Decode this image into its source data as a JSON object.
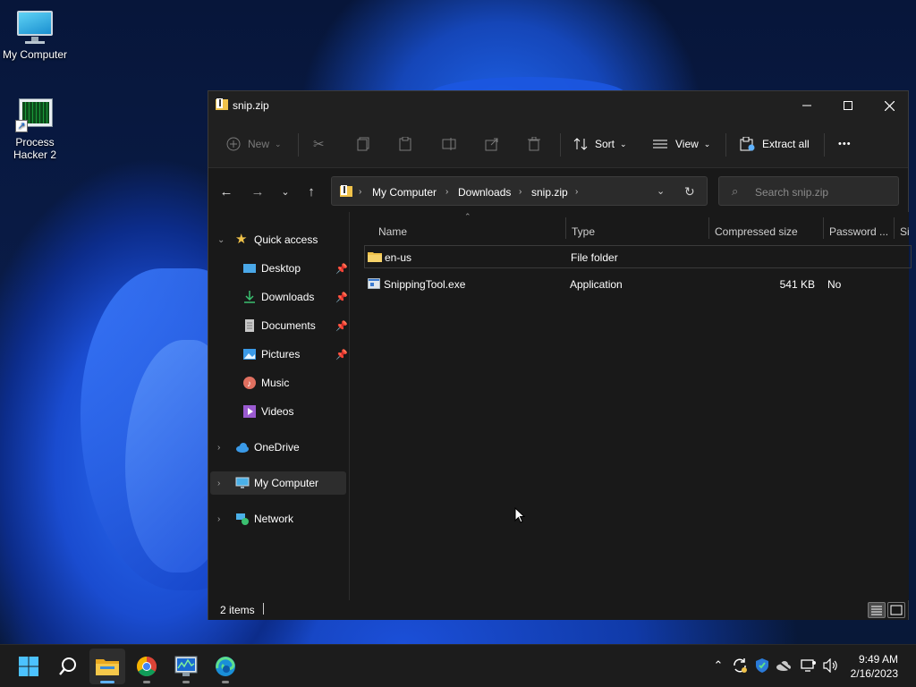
{
  "desktop": {
    "icons": [
      {
        "label": "My Computer"
      },
      {
        "label_line1": "Process",
        "label_line2": "Hacker 2"
      }
    ]
  },
  "window": {
    "title": "snip.zip",
    "controls": {
      "minimize": "—",
      "maximize": "☐",
      "close": "✕"
    }
  },
  "toolbar": {
    "new_label": "New",
    "sort_label": "Sort",
    "view_label": "View",
    "extract_label": "Extract all",
    "more_label": "•••"
  },
  "address": {
    "breadcrumbs": [
      "My Computer",
      "Downloads",
      "snip.zip"
    ],
    "search_placeholder": "Search snip.zip"
  },
  "nav": {
    "quick_access": "Quick access",
    "items": [
      {
        "label": "Desktop",
        "icon": "desktop-icon",
        "pinned": true
      },
      {
        "label": "Downloads",
        "icon": "downloads-icon",
        "pinned": true
      },
      {
        "label": "Documents",
        "icon": "documents-icon",
        "pinned": true
      },
      {
        "label": "Pictures",
        "icon": "pictures-icon",
        "pinned": true
      },
      {
        "label": "Music",
        "icon": "music-icon",
        "pinned": false
      },
      {
        "label": "Videos",
        "icon": "videos-icon",
        "pinned": false
      }
    ],
    "onedrive": "OneDrive",
    "my_computer": "My Computer",
    "network": "Network"
  },
  "columns": {
    "name": "Name",
    "type": "Type",
    "compressed_size": "Compressed size",
    "password": "Password ...",
    "size": "Si"
  },
  "files": [
    {
      "name": "en-us",
      "type": "File folder",
      "compressed_size": "",
      "password": "",
      "icon": "folder-icon"
    },
    {
      "name": "SnippingTool.exe",
      "type": "Application",
      "compressed_size": "541 KB",
      "password": "No",
      "icon": "exe-icon"
    }
  ],
  "status": {
    "items_count": "2 items"
  },
  "taskbar": {
    "apps": [
      "start-icon",
      "search-icon",
      "file-explorer-icon",
      "chrome-icon",
      "process-hacker-icon",
      "edge-icon"
    ],
    "time": "9:49 AM",
    "date": "2/16/2023"
  },
  "colors": {
    "accent": "#5fb2ff",
    "folder": "#f0c24a"
  }
}
